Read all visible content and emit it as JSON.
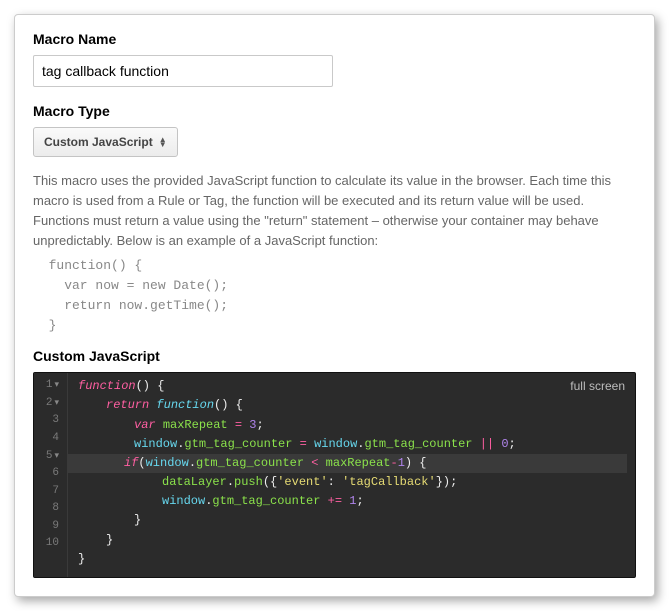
{
  "labels": {
    "macro_name": "Macro Name",
    "macro_type": "Macro Type",
    "custom_js": "Custom JavaScript"
  },
  "macro_name_value": "tag callback function",
  "macro_type_value": "Custom JavaScript",
  "description": "This macro uses the provided JavaScript function to calculate its value in the browser. Each time this macro is used from a Rule or Tag, the function will be executed and its return value will be used. Functions must return a value using the \"return\" statement – otherwise your container may behave unpredictably. Below is an example of a JavaScript function:",
  "example_code": "  function() {\n    var now = new Date();\n    return now.getTime();\n  }",
  "editor": {
    "fullscreen_label": "full screen",
    "gutter": [
      "1",
      "2",
      "3",
      "4",
      "5",
      "6",
      "7",
      "8",
      "9",
      "10"
    ],
    "fold_lines": [
      1,
      2,
      5
    ],
    "highlighted_line": 5,
    "code_tokens": [
      [
        [
          "kw",
          "function"
        ],
        [
          "pun",
          "() {"
        ]
      ],
      [
        [
          "kw",
          "return"
        ],
        [
          "pun",
          " "
        ],
        [
          "fn",
          "function"
        ],
        [
          "pun",
          "() {"
        ]
      ],
      [
        [
          "kw",
          "var"
        ],
        [
          "pun",
          " "
        ],
        [
          "id",
          "maxRepeat"
        ],
        [
          "pun",
          " "
        ],
        [
          "op",
          "="
        ],
        [
          "pun",
          " "
        ],
        [
          "num",
          "3"
        ],
        [
          "pun",
          ";"
        ]
      ],
      [
        [
          "obj",
          "window"
        ],
        [
          "pun",
          "."
        ],
        [
          "id",
          "gtm_tag_counter"
        ],
        [
          "pun",
          " "
        ],
        [
          "op",
          "="
        ],
        [
          "pun",
          " "
        ],
        [
          "obj",
          "window"
        ],
        [
          "pun",
          "."
        ],
        [
          "id",
          "gtm_tag_counter"
        ],
        [
          "pun",
          " "
        ],
        [
          "op",
          "||"
        ],
        [
          "pun",
          " "
        ],
        [
          "num",
          "0"
        ],
        [
          "pun",
          ";"
        ]
      ],
      [
        [
          "kw",
          "if"
        ],
        [
          "pun",
          "("
        ],
        [
          "obj",
          "window"
        ],
        [
          "pun",
          "."
        ],
        [
          "id",
          "gtm_tag_counter"
        ],
        [
          "pun",
          " "
        ],
        [
          "op",
          "<"
        ],
        [
          "pun",
          " "
        ],
        [
          "id",
          "maxRepeat"
        ],
        [
          "op",
          "-"
        ],
        [
          "num",
          "1"
        ],
        [
          "pun",
          ") {"
        ]
      ],
      [
        [
          "id",
          "dataLayer"
        ],
        [
          "pun",
          "."
        ],
        [
          "id",
          "push"
        ],
        [
          "pun",
          "({"
        ],
        [
          "str",
          "'event'"
        ],
        [
          "pun",
          ": "
        ],
        [
          "str",
          "'tagCallback'"
        ],
        [
          "pun",
          "});"
        ]
      ],
      [
        [
          "obj",
          "window"
        ],
        [
          "pun",
          "."
        ],
        [
          "id",
          "gtm_tag_counter"
        ],
        [
          "pun",
          " "
        ],
        [
          "op",
          "+="
        ],
        [
          "pun",
          " "
        ],
        [
          "num",
          "1"
        ],
        [
          "pun",
          ";"
        ]
      ],
      [
        [
          "pun",
          "}"
        ]
      ],
      [
        [
          "pun",
          "}"
        ]
      ],
      [
        [
          "pun",
          "}"
        ]
      ]
    ],
    "indent": [
      0,
      1,
      2,
      2,
      2,
      3,
      3,
      2,
      1,
      0
    ]
  }
}
